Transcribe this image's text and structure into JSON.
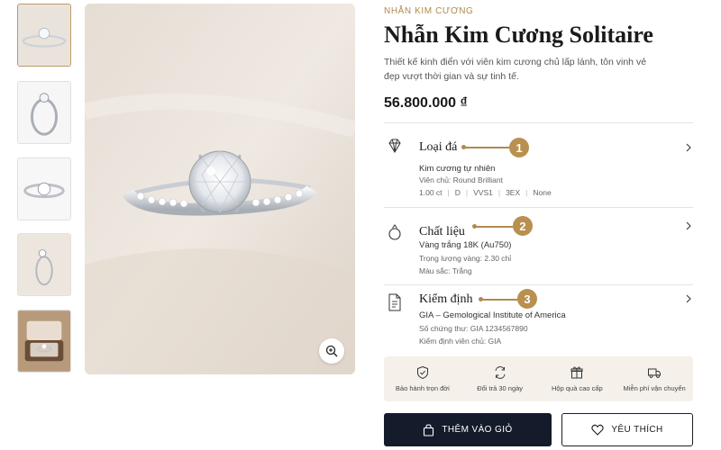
{
  "product": {
    "category": "NHẪN KIM CƯƠNG",
    "title": "Nhẫn Kim Cương Solitaire",
    "description": "Thiết kế kinh điển với viên kim cương chủ lấp lánh, tôn vinh vẻ đẹp vượt thời gian và sự tinh tế.",
    "price": "56.800.000 ₫"
  },
  "gallery": {
    "thumbnails": [
      {
        "icon": "ring-side-view"
      },
      {
        "icon": "ring-profile-view"
      },
      {
        "icon": "ring-top-view"
      },
      {
        "icon": "ring-angled-view"
      },
      {
        "icon": "ring-in-box"
      }
    ],
    "active_index": 0,
    "zoom_icon": "zoom-in-icon"
  },
  "sections": [
    {
      "title": "Loại đá",
      "badge": "1",
      "icon": "diamond-icon",
      "main": "Kim cương tự nhiên",
      "line2": "Viên chủ: Round Brilliant",
      "specs": [
        "1.00 ct",
        "D",
        "VVS1",
        "3EX",
        "None"
      ]
    },
    {
      "title": "Chất liệu",
      "badge": "2",
      "icon": "ring-icon",
      "main": "Vàng trắng 18K (Au750)",
      "line2": "Trọng lượng vàng: 2.30 chỉ",
      "line3": "Màu sắc: Trắng"
    },
    {
      "title": "Kiểm định",
      "badge": "3",
      "icon": "certificate-icon",
      "main": "GIA – Gemological Institute of America",
      "line2": "Số chứng thư: GIA 1234567890",
      "line3": "Kiểm định viên chủ: GIA"
    }
  ],
  "benefits": [
    {
      "icon": "shield-check-icon",
      "label": "Bảo hành trọn đời"
    },
    {
      "icon": "exchange-icon",
      "label": "Đổi trả 30 ngày"
    },
    {
      "icon": "gift-icon",
      "label": "Hộp quà cao cấp"
    },
    {
      "icon": "truck-icon",
      "label": "Miễn phí vận chuyển"
    }
  ],
  "actions": {
    "add_to_cart": "THÊM VÀO GIỎ",
    "favorite": "YÊU THÍCH"
  },
  "colors": {
    "accent": "#b9904f",
    "primary_button": "#141b2b",
    "benefits_bg": "#f5f1ea"
  }
}
